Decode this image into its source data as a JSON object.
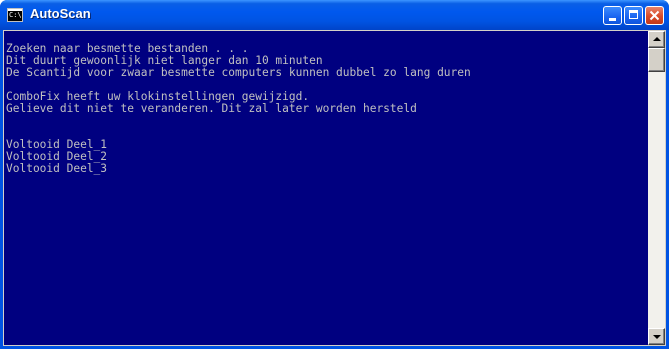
{
  "window": {
    "title": "AutoScan",
    "icon": "console-icon",
    "icon_text": "C:\\"
  },
  "titlebar_buttons": {
    "minimize": "minimize-icon",
    "maximize": "maximize-icon",
    "close": "close-icon"
  },
  "console": {
    "background": "#000080",
    "text_color": "#c0c0c0",
    "lines": [
      "Zoeken naar besmette bestanden . . .",
      "Dit duurt gewoonlijk niet langer dan 10 minuten",
      "De Scantijd voor zwaar besmette computers kunnen dubbel zo lang duren",
      "",
      "ComboFix heeft uw klokinstellingen gewijzigd.",
      "Gelieve dit niet te veranderen. Dit zal later worden hersteld",
      "",
      "",
      "Voltooid Deel_1",
      "Voltooid Deel_2",
      "Voltooid Deel_3"
    ]
  },
  "scrollbar": {
    "position_fraction": 0
  }
}
